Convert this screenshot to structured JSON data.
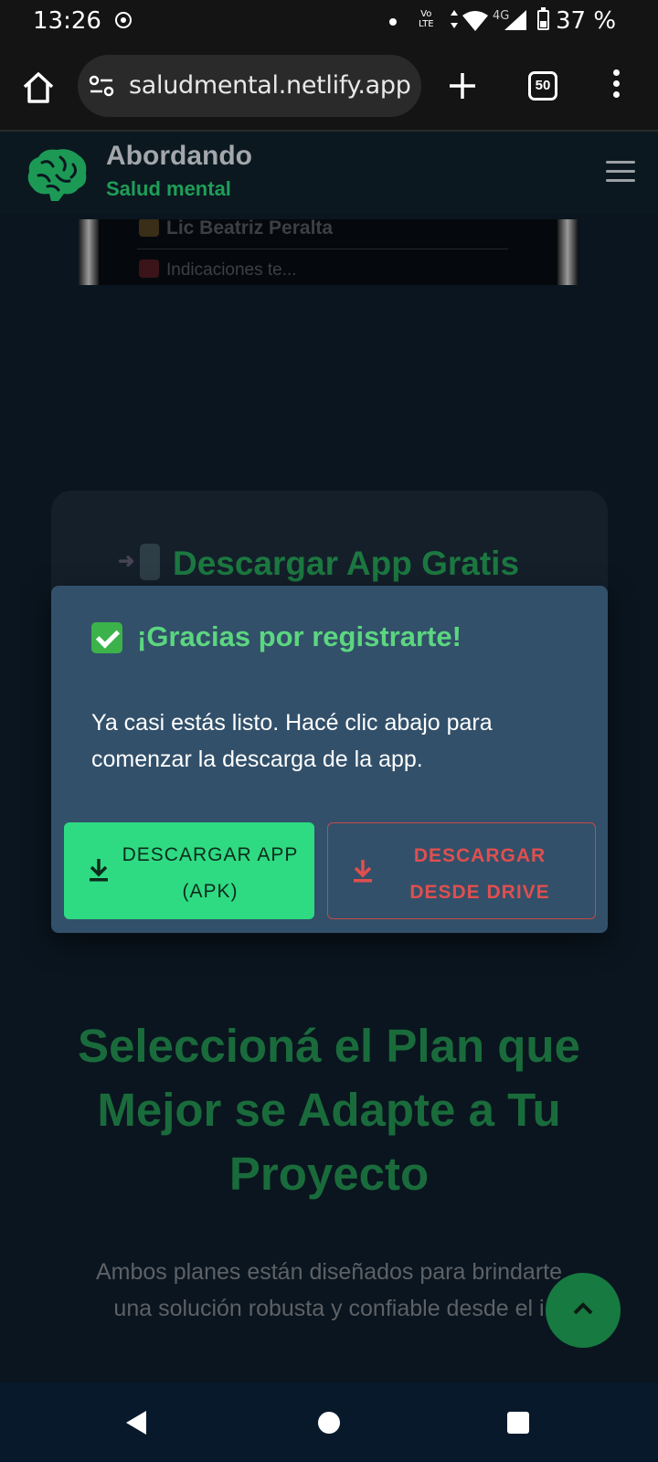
{
  "status_bar": {
    "time": "13:26",
    "volte": "Vo\nLTE",
    "network": "4G",
    "battery_percent": "37 %",
    "battery_level": 0.37
  },
  "browser": {
    "url": "saludmental.netlify.app",
    "tab_count": "50"
  },
  "site_header": {
    "title": "Abordando",
    "subtitle": "Salud mental",
    "brand_color": "#1f9e57"
  },
  "peek_card": {
    "line1": "Lic Beatriz Peralta",
    "line2": "Indicaciones te..."
  },
  "download_card": {
    "title": "Descargar App Gratis"
  },
  "modal": {
    "title": "¡Gracias por registrarte!",
    "body": "Ya casi estás listo. Hacé clic abajo para comenzar la descarga de la app.",
    "apk_button_label": "DESCARGAR APP (APK)",
    "drive_button_label": "DESCARGAR DESDE DRIVE",
    "apk_color": "#2edb82",
    "drive_color": "#e04f4f"
  },
  "plans": {
    "title": "Seleccioná el Plan que Mejor se Adapte a Tu Proyecto",
    "subtitle_line1": "Ambos planes están diseñados para brindarte",
    "subtitle_line2": "una solución robusta y confiable desde el i"
  }
}
